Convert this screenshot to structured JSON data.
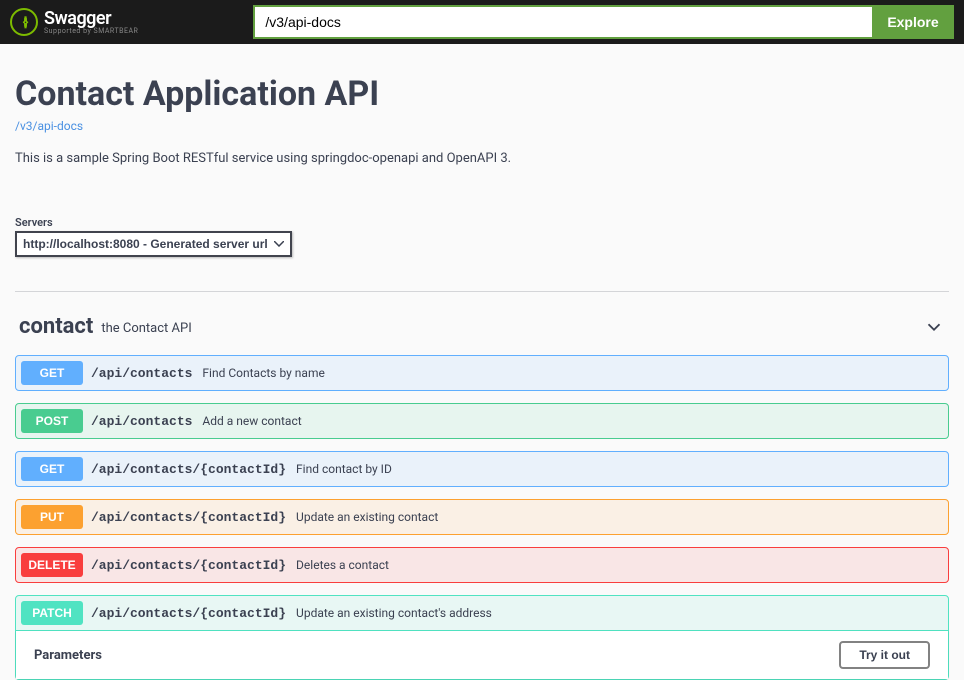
{
  "topbar": {
    "logo_glyph": "{ }",
    "logo_main": "Swagger",
    "logo_sub": "Supported by SMARTBEAR",
    "search_value": "/v3/api-docs",
    "explore_label": "Explore"
  },
  "info": {
    "title": "Contact Application API",
    "docs_link": "/v3/api-docs",
    "description": "This is a sample Spring Boot RESTful service using springdoc-openapi and OpenAPI 3."
  },
  "servers": {
    "label": "Servers",
    "selected": "http://localhost:8080 - Generated server url"
  },
  "tag": {
    "name": "contact",
    "description": "the Contact API"
  },
  "ops": [
    {
      "method": "GET",
      "path": "/api/contacts",
      "summary": "Find Contacts by name"
    },
    {
      "method": "POST",
      "path": "/api/contacts",
      "summary": "Add a new contact"
    },
    {
      "method": "GET",
      "path": "/api/contacts/{contactId}",
      "summary": "Find contact by ID"
    },
    {
      "method": "PUT",
      "path": "/api/contacts/{contactId}",
      "summary": "Update an existing contact"
    },
    {
      "method": "DELETE",
      "path": "/api/contacts/{contactId}",
      "summary": "Deletes a contact"
    },
    {
      "method": "PATCH",
      "path": "/api/contacts/{contactId}",
      "summary": "Update an existing contact's address"
    }
  ],
  "expanded": {
    "parameters_label": "Parameters",
    "try_label": "Try it out"
  }
}
